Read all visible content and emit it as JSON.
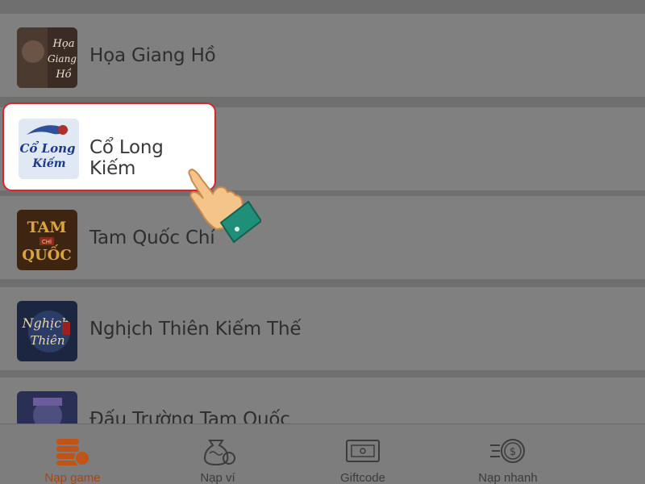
{
  "games": [
    {
      "name": "Họa Giang Hồ",
      "icon": "hoa-giang-ho-logo",
      "logo_text": [
        "Họa",
        "Giang",
        "Hồ"
      ]
    },
    {
      "name": "Cổ Long Kiếm",
      "icon": "co-long-kiem-logo",
      "logo_text": [
        "Cổ Long",
        "Kiếm"
      ]
    },
    {
      "name": "Tam Quốc Chí",
      "icon": "tam-quoc-chi-logo",
      "logo_text": [
        "TAM",
        "CHÍ",
        "QUỐC"
      ]
    },
    {
      "name": "Nghịch Thiên Kiếm Thế",
      "icon": "nghich-thien-kiem-the-logo",
      "logo_text": [
        "Nghịch",
        "Thiên"
      ]
    },
    {
      "name": "Đấu Trường Tam Quốc",
      "icon": "dau-truong-tam-quoc-logo",
      "logo_text": []
    }
  ],
  "highlighted_game": "Cổ Long Kiếm",
  "tabs": [
    {
      "label": "Nạp game",
      "icon": "coin-stack-icon",
      "active": true
    },
    {
      "label": "Nạp ví",
      "icon": "money-bag-icon",
      "active": false
    },
    {
      "label": "Giftcode",
      "icon": "ticket-icon",
      "active": false
    },
    {
      "label": "Nạp nhanh",
      "icon": "fast-coin-icon",
      "active": false
    }
  ],
  "colors": {
    "accent": "#d9232d",
    "active_tab": "#a54613",
    "overlay": "#808080"
  }
}
